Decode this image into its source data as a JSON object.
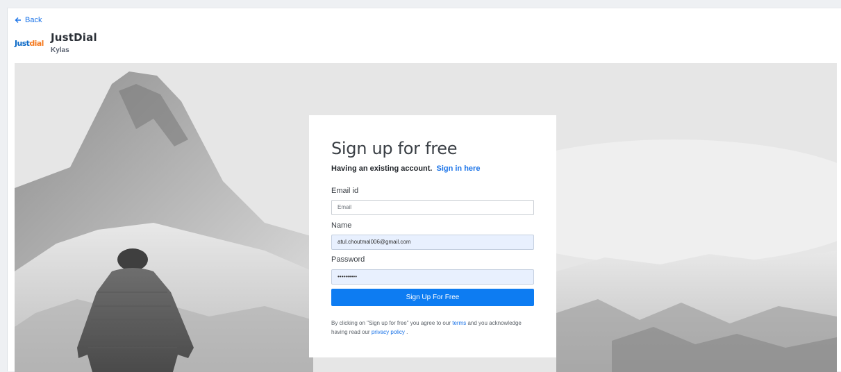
{
  "nav": {
    "back_label": "Back"
  },
  "app": {
    "logo_just": "Just",
    "logo_dial": "dial",
    "name": "JustDial",
    "vendor": "Kylas"
  },
  "signup": {
    "title": "Sign up for free",
    "existing_text": "Having an existing account.",
    "signin_link": "Sign in here",
    "email_label": "Email id",
    "email_placeholder": "Email",
    "name_label": "Name",
    "name_value": "atul.choutmal006@gmail.com",
    "password_label": "Password",
    "password_value": "••••••••••",
    "submit_label": "Sign Up For Free",
    "terms_prefix": "By clicking on \"Sign up for free\" you agree to our",
    "terms_link": "terms",
    "terms_middle": "and you acknowledge having read our",
    "privacy_link": "privacy policy",
    "terms_suffix": "."
  },
  "colors": {
    "accent": "#0d7cf2",
    "link": "#1a73e8",
    "autofill": "#e8f0fe",
    "logo_blue": "#0b69c7",
    "logo_orange": "#f47a20"
  }
}
